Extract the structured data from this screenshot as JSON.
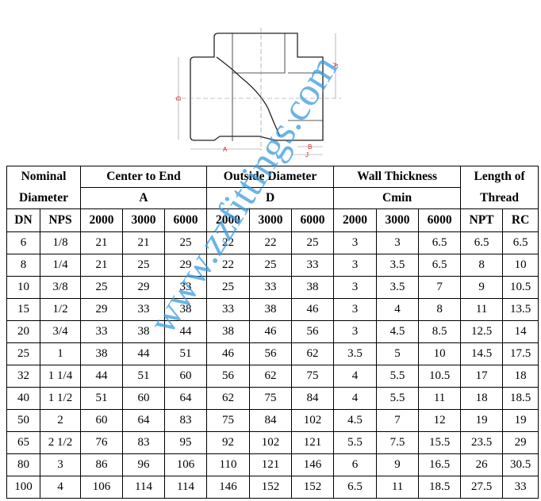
{
  "drawing": {
    "labels": [
      "A",
      "D",
      "A",
      "B",
      "J"
    ]
  },
  "table": {
    "group_headers": [
      {
        "top": "Nominal",
        "bottom": "Diameter"
      },
      {
        "top": "Center to End",
        "bottom": "A"
      },
      {
        "top": "Outside Diameter",
        "bottom": "D"
      },
      {
        "top": "Wall Thickness",
        "bottom": "Cmin"
      },
      {
        "top": "Length of",
        "bottom": "Thread"
      }
    ],
    "columns": [
      "DN",
      "NPS",
      "2000",
      "3000",
      "6000",
      "2000",
      "3000",
      "6000",
      "2000",
      "3000",
      "6000",
      "NPT",
      "RC"
    ],
    "rows": [
      [
        "6",
        "1/8",
        "21",
        "21",
        "25",
        "22",
        "22",
        "25",
        "3",
        "3",
        "6.5",
        "6.5",
        "6.5"
      ],
      [
        "8",
        "1/4",
        "21",
        "25",
        "29",
        "22",
        "25",
        "33",
        "3",
        "3.5",
        "6.5",
        "8",
        "10"
      ],
      [
        "10",
        "3/8",
        "25",
        "29",
        "33",
        "25",
        "33",
        "38",
        "3",
        "3.5",
        "7",
        "9",
        "10.5"
      ],
      [
        "15",
        "1/2",
        "29",
        "33",
        "38",
        "33",
        "38",
        "46",
        "3",
        "4",
        "8",
        "11",
        "13.5"
      ],
      [
        "20",
        "3/4",
        "33",
        "38",
        "44",
        "38",
        "46",
        "56",
        "3",
        "4.5",
        "8.5",
        "12.5",
        "14"
      ],
      [
        "25",
        "1",
        "38",
        "44",
        "51",
        "46",
        "56",
        "62",
        "3.5",
        "5",
        "10",
        "14.5",
        "17.5"
      ],
      [
        "32",
        "1 1/4",
        "44",
        "51",
        "60",
        "56",
        "62",
        "75",
        "4",
        "5.5",
        "10.5",
        "17",
        "18"
      ],
      [
        "40",
        "1 1/2",
        "51",
        "60",
        "64",
        "62",
        "75",
        "84",
        "4",
        "5.5",
        "11",
        "18",
        "18.5"
      ],
      [
        "50",
        "2",
        "60",
        "64",
        "83",
        "75",
        "84",
        "102",
        "4.5",
        "7",
        "12",
        "19",
        "19"
      ],
      [
        "65",
        "2 1/2",
        "76",
        "83",
        "95",
        "92",
        "102",
        "121",
        "5.5",
        "7.5",
        "15.5",
        "23.5",
        "29"
      ],
      [
        "80",
        "3",
        "86",
        "96",
        "106",
        "110",
        "121",
        "146",
        "6",
        "9",
        "16.5",
        "26",
        "30.5"
      ],
      [
        "100",
        "4",
        "106",
        "114",
        "114",
        "146",
        "152",
        "152",
        "6.5",
        "11",
        "18.5",
        "27.5",
        "33"
      ]
    ]
  },
  "watermark": "www.zzfittings.com",
  "colors": {
    "watermark": "#3a9be0",
    "dimension_label": "#e02020"
  }
}
